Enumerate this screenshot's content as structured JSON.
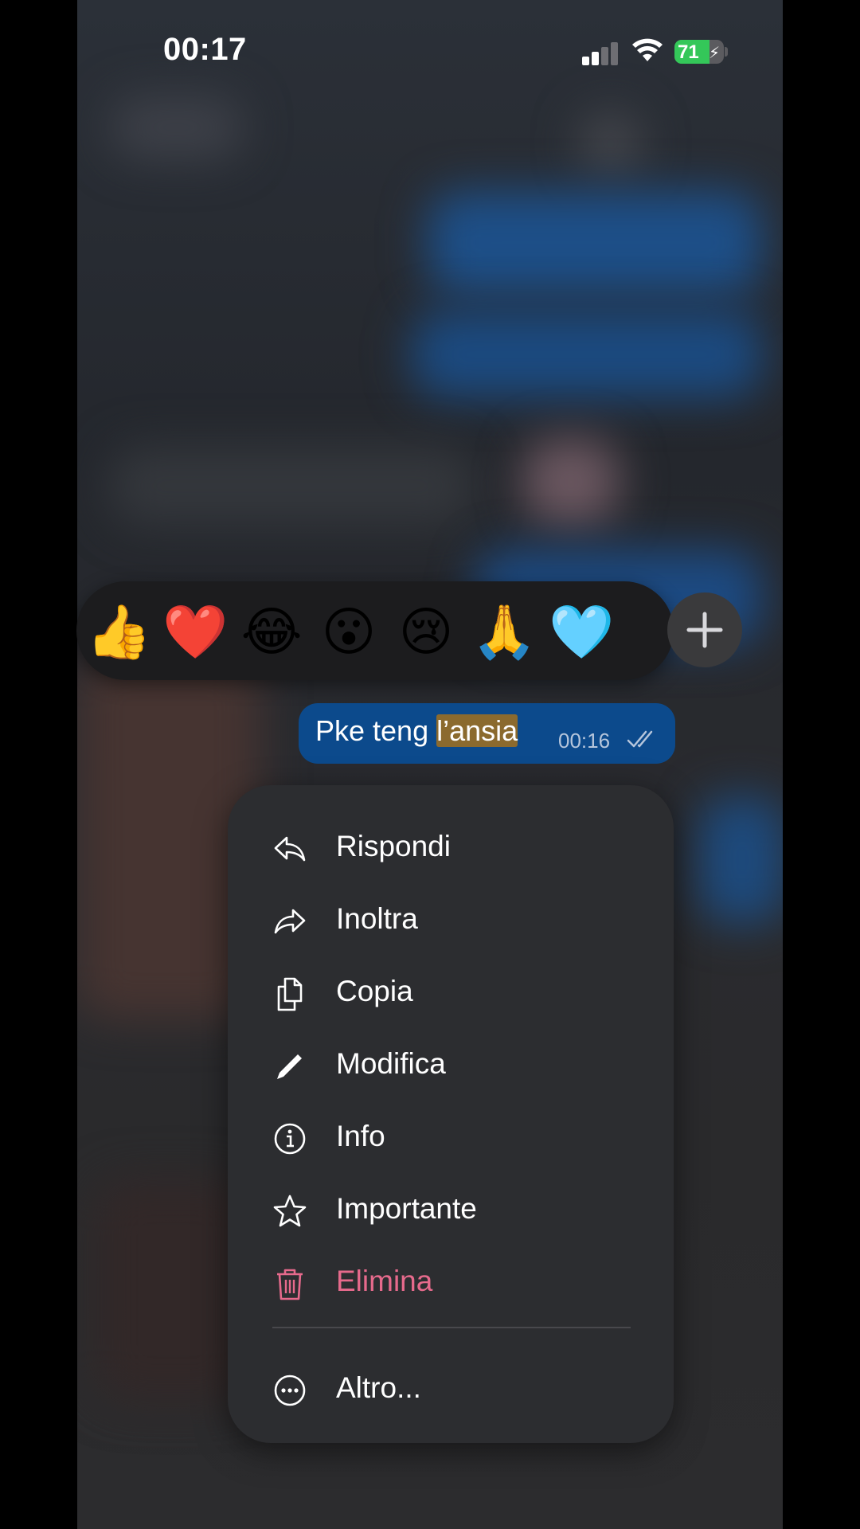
{
  "status_bar": {
    "time": "00:17",
    "battery": "71",
    "battery_level": 0.71
  },
  "reactions": {
    "emojis": [
      {
        "name": "thumbs-up",
        "char": "👍"
      },
      {
        "name": "red-heart",
        "char": "❤️"
      },
      {
        "name": "face-with-tears-of-joy",
        "char": "😂"
      },
      {
        "name": "face-with-open-mouth",
        "char": "😮"
      },
      {
        "name": "crying-face",
        "char": "😢"
      },
      {
        "name": "folded-hands",
        "char": "🙏"
      },
      {
        "name": "light-blue-heart",
        "char": "🩵"
      }
    ],
    "more_icon": "plus-icon"
  },
  "message": {
    "text_plain": "Pke teng ",
    "text_selected": "l’ansia",
    "time": "00:16",
    "status": "read",
    "bubble_color": "#0c4a8c",
    "selection_color": "#8b6a2e"
  },
  "menu": {
    "items": [
      {
        "label": "Rispondi",
        "icon": "reply-icon"
      },
      {
        "label": "Inoltra",
        "icon": "forward-icon"
      },
      {
        "label": "Copia",
        "icon": "copy-icon"
      },
      {
        "label": "Modifica",
        "icon": "pencil-icon"
      },
      {
        "label": "Info",
        "icon": "info-icon"
      },
      {
        "label": "Importante",
        "icon": "star-icon"
      },
      {
        "label": "Elimina",
        "icon": "trash-icon",
        "destructive": true
      }
    ],
    "more": {
      "label": "Altro...",
      "icon": "ellipsis-circle-icon"
    },
    "destructive_color": "#e66a8c"
  }
}
